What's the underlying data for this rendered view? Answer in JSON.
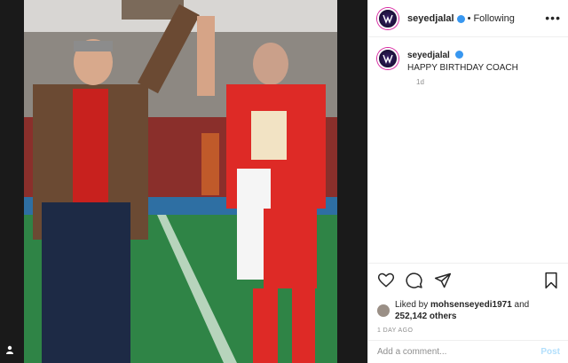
{
  "post": {
    "username": "seyedjalal",
    "follow_status": "Following",
    "separator": "•",
    "more": "•••",
    "caption": "HAPPY BIRTHDAY COACH",
    "caption_time": "1d",
    "likes_intro": "Liked by ",
    "liked_by": "mohsenseyedi1971",
    "likes_and": " and",
    "likes_others": "252,142 others",
    "post_date": "1 DAY AGO",
    "comment_placeholder": "Add a comment...",
    "post_label": "Post"
  },
  "icons": {
    "like": "heart-icon",
    "comment": "comment-icon",
    "share": "share-icon",
    "save": "bookmark-icon",
    "user_tag": "user-tag-icon"
  },
  "colors": {
    "accent": "#3897f0",
    "post_disabled": "#b2dffc"
  }
}
